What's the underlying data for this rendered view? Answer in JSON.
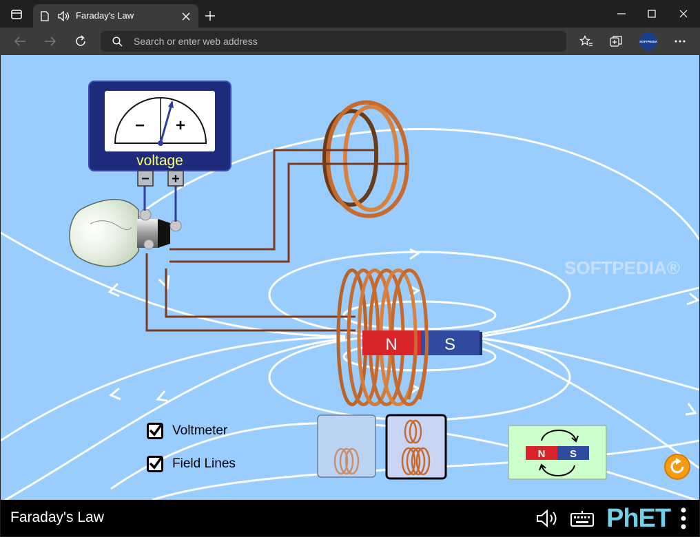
{
  "browser": {
    "tab_title": "Faraday's Law",
    "address_placeholder": "Search or enter web address",
    "profile_label": "SOFTPEDIA"
  },
  "sim": {
    "voltmeter_label": "voltage",
    "meter_minus": "−",
    "meter_plus": "+",
    "terminal_minus": "−",
    "terminal_plus": "+",
    "magnet_north": "N",
    "magnet_south": "S",
    "flip_north": "N",
    "flip_south": "S",
    "voltmeter_checkbox_label": "Voltmeter",
    "field_lines_checkbox_label": "Field Lines",
    "voltmeter_checked": true,
    "field_lines_checked": true,
    "watermark": "SOFTPEDIA®",
    "colors": {
      "background": "#99ccff",
      "copper": "#c76a2e",
      "north": "#d9232a",
      "south": "#2f4a9e",
      "voltmeter_panel": "#1f2a7a",
      "voltmeter_label": "#ffff66",
      "reset": "#f39c12"
    }
  },
  "footer": {
    "title": "Faraday's Law",
    "brand": "PhET"
  }
}
